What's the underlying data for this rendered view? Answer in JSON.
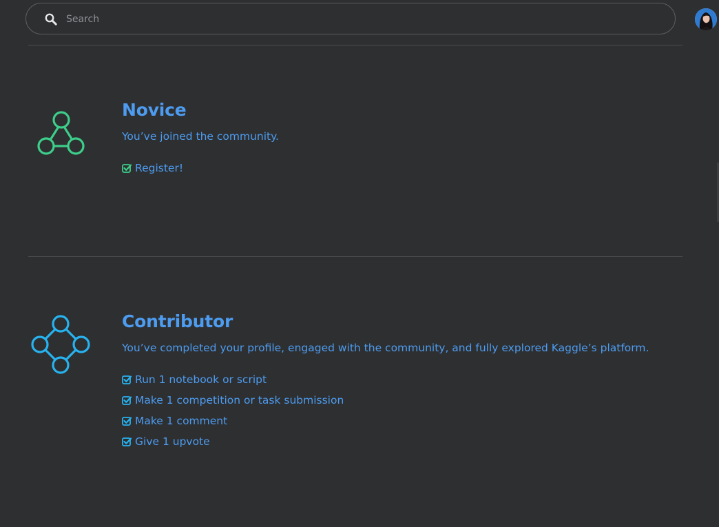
{
  "search": {
    "placeholder": "Search",
    "value": ""
  },
  "colors": {
    "background": "#2e2f31",
    "text_blue": "#4d9cf0",
    "novice_green": "#3dce8a",
    "contributor_blue": "#27b3ef",
    "divider": "#4b4d51"
  },
  "tiers": [
    {
      "title": "Novice",
      "description": "You’ve joined the community.",
      "icon": "novice-tier-icon",
      "requirements": [
        "Register!"
      ]
    },
    {
      "title": "Contributor",
      "description": "You’ve completed your profile, engaged with the community, and fully explored Kaggle’s platform.",
      "icon": "contributor-tier-icon",
      "requirements": [
        "Run 1 notebook or script",
        "Make 1 competition or task submission",
        "Make 1 comment",
        "Give 1 upvote"
      ]
    }
  ]
}
